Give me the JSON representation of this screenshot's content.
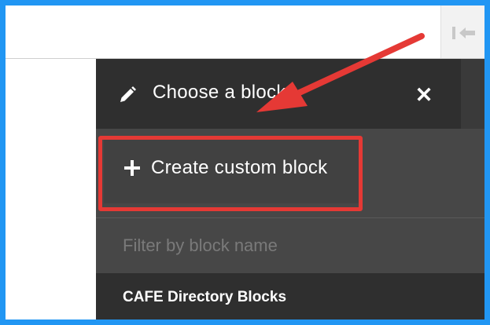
{
  "panel": {
    "title": "Choose a block",
    "close_label": "✕",
    "create_label": "Create custom block",
    "filter_placeholder": "Filter by block name",
    "category": "CAFE Directory Blocks"
  },
  "icons": {
    "header": "pencil-icon",
    "close": "close-icon",
    "create": "plus-icon",
    "collapse": "collapse-arrow-icon"
  },
  "annotations": {
    "highlight_color": "#e53935",
    "arrow_color": "#e53935",
    "frame_color": "#2196f3"
  }
}
